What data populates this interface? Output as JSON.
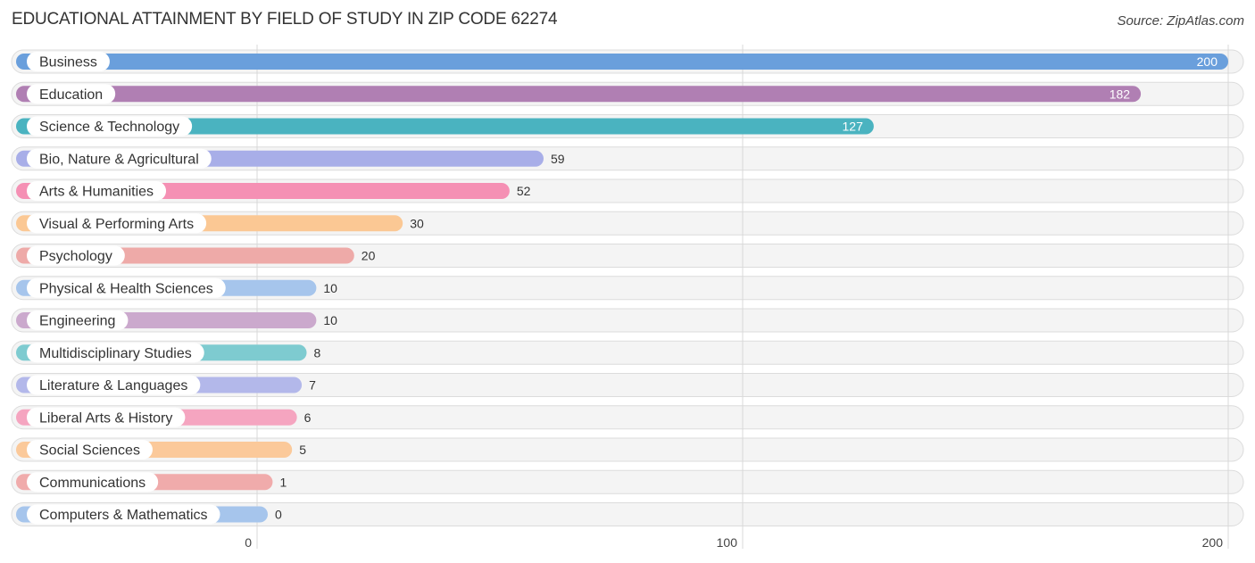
{
  "title": "EDUCATIONAL ATTAINMENT BY FIELD OF STUDY IN ZIP CODE 62274",
  "source": "Source: ZipAtlas.com",
  "chart_data": {
    "type": "bar",
    "orientation": "horizontal",
    "title": "EDUCATIONAL ATTAINMENT BY FIELD OF STUDY IN ZIP CODE 62274",
    "xlabel": "",
    "ylabel": "",
    "xlim": [
      0,
      200
    ],
    "ticks": [
      0,
      100,
      200
    ],
    "tick_labels": [
      "0",
      "100",
      "200"
    ],
    "grid": true,
    "categories": [
      "Business",
      "Education",
      "Science & Technology",
      "Bio, Nature & Agricultural",
      "Arts & Humanities",
      "Visual & Performing Arts",
      "Psychology",
      "Physical & Health Sciences",
      "Engineering",
      "Multidisciplinary Studies",
      "Literature & Languages",
      "Liberal Arts & History",
      "Social Sciences",
      "Communications",
      "Computers & Mathematics"
    ],
    "values": [
      200,
      182,
      127,
      59,
      52,
      30,
      20,
      10,
      10,
      8,
      7,
      6,
      5,
      1,
      0
    ],
    "colors": [
      "#6a9fdc",
      "#b07fb3",
      "#4ab3c0",
      "#a8aee8",
      "#f590b4",
      "#fbc894",
      "#eeaaa8",
      "#a6c5ec",
      "#cba9cd",
      "#7ecbd0",
      "#b3b8ea",
      "#f5a5c0",
      "#fbc99a",
      "#f0abab",
      "#a6c5ec"
    ]
  }
}
